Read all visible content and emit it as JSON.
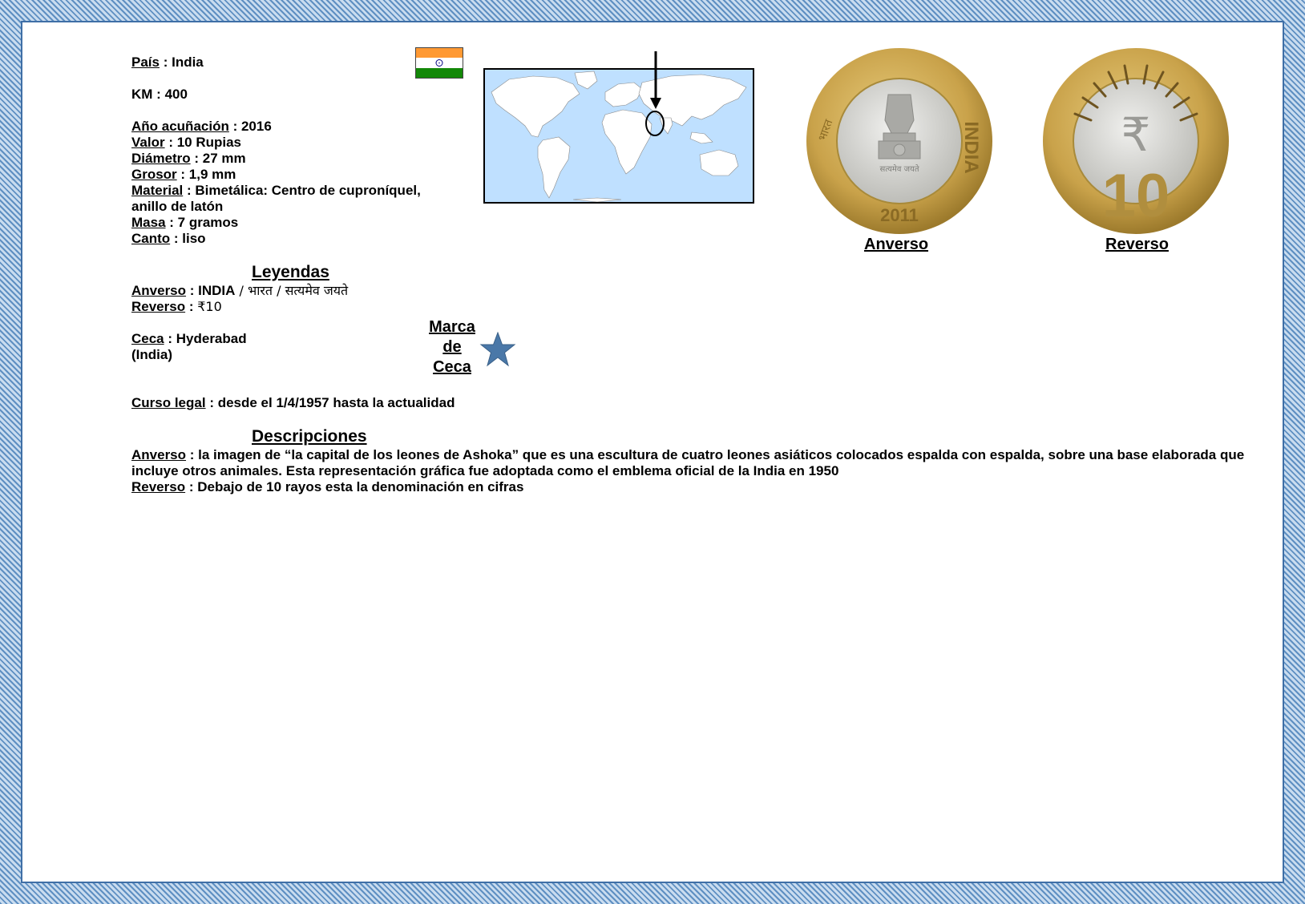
{
  "fields": {
    "pais": {
      "label": "País",
      "value": "India"
    },
    "km": {
      "label": "KM",
      "value": "400"
    },
    "ano": {
      "label": "Año acuñación",
      "value": "2016"
    },
    "valor": {
      "label": "Valor",
      "value": "10 Rupias"
    },
    "diametro": {
      "label": "Diámetro",
      "value": "27 mm"
    },
    "grosor": {
      "label": "Grosor",
      "value": "1,9 mm"
    },
    "material": {
      "label": "Material",
      "value_line1": "Bimetálica: Centro de cuproníquel,",
      "value_line2": "anillo de latón"
    },
    "masa": {
      "label": "Masa",
      "value": "7 gramos"
    },
    "canto": {
      "label": "Canto",
      "value": "liso"
    }
  },
  "leyendas": {
    "heading": "Leyendas",
    "anverso": {
      "label": "Anverso",
      "value_bold": "INDIA",
      "value_rest": " / भारत / सत्यमेव जयते"
    },
    "reverso": {
      "label": "Reverso",
      "value": "₹10"
    }
  },
  "ceca": {
    "label": "Ceca",
    "value_line1": "Hyderabad",
    "value_line2": "(India)",
    "mark_label_1": "Marca",
    "mark_label_2": "de",
    "mark_label_3": "Ceca"
  },
  "curso_legal": {
    "label": "Curso legal",
    "value": "desde el 1/4/1957 hasta la actualidad"
  },
  "descripciones": {
    "heading": "Descripciones",
    "anverso": {
      "label": "Anverso",
      "value": "la imagen de “la capital de los leones de Ashoka” que es una escultura de cuatro leones asiáticos colocados espalda con espalda, sobre una base elaborada que incluye otros animales. Esta representación gráfica fue adoptada como el emblema oficial de la India en 1950"
    },
    "reverso": {
      "label": "Reverso",
      "value": "Debajo de 10 rayos esta la denominación en cifras"
    }
  },
  "coins": {
    "obverse": {
      "caption": "Anverso",
      "text_top_left": "भारत",
      "text_right": "INDIA",
      "year": "2011",
      "motto": "सत्यमेव जयते"
    },
    "reverse": {
      "caption": "Reverso",
      "symbol": "₹",
      "denomination": "10"
    }
  },
  "colors": {
    "frame": "#7ea7cf",
    "flag_saffron": "#ff9933",
    "flag_white": "#ffffff",
    "flag_green": "#138808",
    "chakra": "#000080",
    "map_sea": "#bfe0ff",
    "mint_star": "#4a78a8",
    "coin_ring": "#c9a24a",
    "coin_center": "#d9d9d6"
  }
}
